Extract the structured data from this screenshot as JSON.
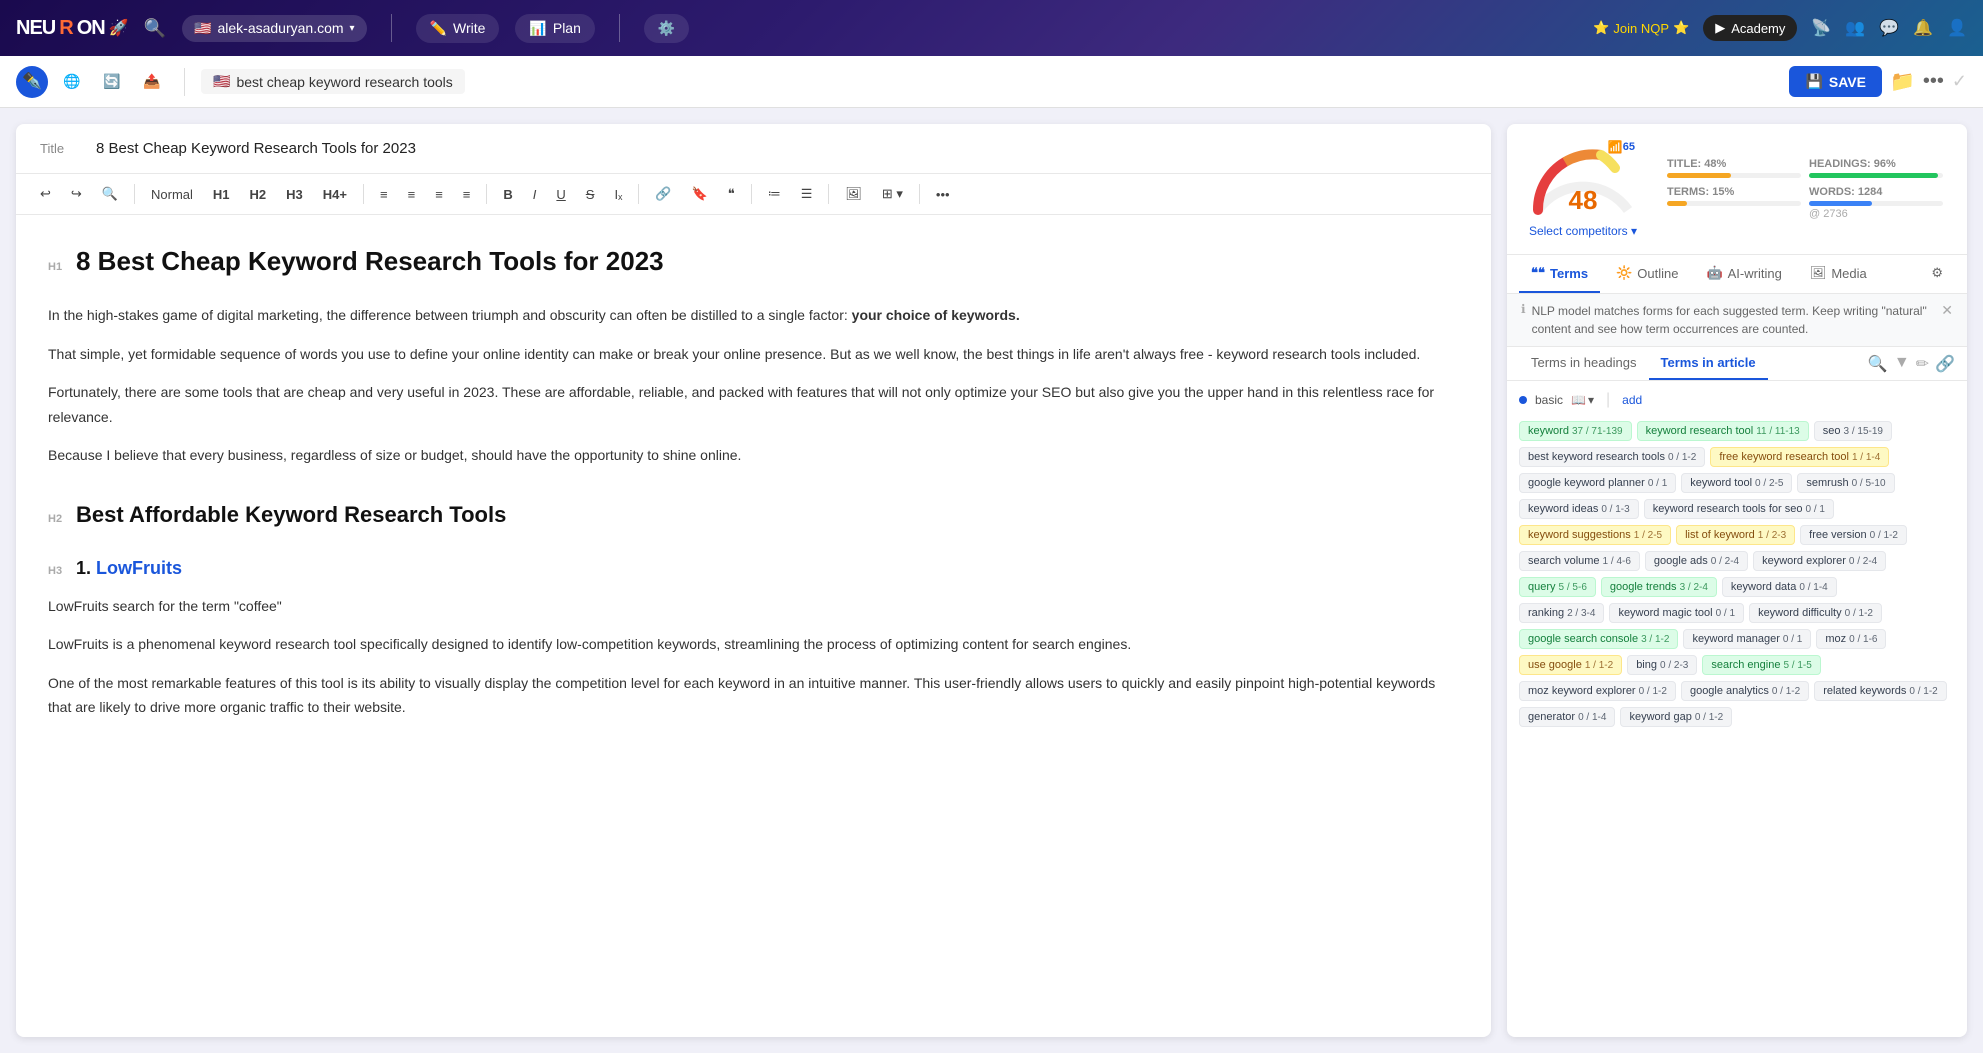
{
  "navbar": {
    "logo": "NEURON",
    "logo_icon": "🚀",
    "domain": "alek-asaduryan.com",
    "flag": "🇺🇸",
    "write_label": "Write",
    "plan_label": "Plan",
    "join_nqp_label": "Join NQP",
    "academy_label": "Academy",
    "write_icon": "✏️",
    "plan_icon": "📊"
  },
  "toolbar2": {
    "doc_title": "best cheap keyword research tools",
    "flag": "🇺🇸",
    "save_label": "SAVE"
  },
  "editor": {
    "title_label": "Title",
    "title_text": "8 Best Cheap Keyword Research Tools for 2023",
    "h1_text": "8 Best Cheap Keyword Research Tools for 2023",
    "h2_1": "Best Affordable Keyword Research Tools",
    "h3_1": "1. LowFruits",
    "p1": "In the high-stakes game of digital marketing, the difference between triumph and obscurity can often be distilled to a single factor: your choice of keywords.",
    "p2": "That simple, yet formidable sequence of words you use to define your online identity can make or break your online presence. But as we well know, the best things in life aren't always free - keyword research tools included.",
    "p3": "Fortunately, there are some tools that are cheap and very useful in 2023. These are affordable, reliable, and packed with features that will not only optimize your SEO but also give you the upper hand in this relentless race for relevance.",
    "p4": "Because I believe that every business, regardless of size or budget, should have the opportunity to shine online.",
    "h3_1_sub1": "LowFruits search for the term \"coffee\"",
    "h3_1_p1": "LowFruits is a phenomenal keyword research tool specifically designed to identify low-competition keywords, streamlining the process of optimizing content for search engines.",
    "h3_1_p2": "One of the most remarkable features of this tool is its ability to visually display the competition level for each keyword in an intuitive manner. This user-friendly allows users to quickly and easily pinpoint high-potential keywords that are likely to drive more organic traffic to their website."
  },
  "score_panel": {
    "score_number": "48",
    "score_wifi": "65",
    "select_competitors": "Select competitors ▾",
    "title_pct": "TITLE: 48%",
    "headings_pct": "HEADINGS: 96%",
    "terms_pct": "TERMS: 15%",
    "words_pct": "WORDS: 1284",
    "words_sub": "@ 2736"
  },
  "right_tabs": {
    "terms_label": "Terms",
    "outline_label": "Outline",
    "ai_writing_label": "AI-writing",
    "media_label": "Media"
  },
  "nlp_notice": "NLP model matches forms for each suggested term. Keep writing \"natural\" content and see how term occurrences are counted.",
  "sub_tabs": {
    "headings_label": "Terms in headings",
    "article_label": "Terms in article"
  },
  "basic_section": {
    "label": "basic",
    "add_label": "add"
  },
  "tags": [
    {
      "text": "keyword",
      "count": "37 / 71-139",
      "type": "green"
    },
    {
      "text": "keyword research tool",
      "count": "11 / 11-13",
      "type": "green"
    },
    {
      "text": "seo",
      "count": "3 / 15-19",
      "type": "gray"
    },
    {
      "text": "best keyword research tools",
      "count": "0 / 1-2",
      "type": "gray"
    },
    {
      "text": "free keyword research tool",
      "count": "1 / 1-4",
      "type": "yellow"
    },
    {
      "text": "google keyword planner",
      "count": "0 / 1",
      "type": "gray"
    },
    {
      "text": "keyword tool",
      "count": "0 / 2-5",
      "type": "gray"
    },
    {
      "text": "semrush",
      "count": "0 / 5-10",
      "type": "gray"
    },
    {
      "text": "keyword ideas",
      "count": "0 / 1-3",
      "type": "gray"
    },
    {
      "text": "keyword research tools for seo",
      "count": "0 / 1",
      "type": "gray"
    },
    {
      "text": "keyword suggestions",
      "count": "1 / 2-5",
      "type": "yellow"
    },
    {
      "text": "list of keyword",
      "count": "1 / 2-3",
      "type": "yellow"
    },
    {
      "text": "free version",
      "count": "0 / 1-2",
      "type": "gray"
    },
    {
      "text": "search volume",
      "count": "1 / 4-6",
      "type": "gray"
    },
    {
      "text": "google ads",
      "count": "0 / 2-4",
      "type": "gray"
    },
    {
      "text": "keyword explorer",
      "count": "0 / 2-4",
      "type": "gray"
    },
    {
      "text": "query",
      "count": "5 / 5-6",
      "type": "green"
    },
    {
      "text": "google trends",
      "count": "3 / 2-4",
      "type": "green"
    },
    {
      "text": "keyword data",
      "count": "0 / 1-4",
      "type": "gray"
    },
    {
      "text": "ranking",
      "count": "2 / 3-4",
      "type": "gray"
    },
    {
      "text": "keyword magic tool",
      "count": "0 / 1",
      "type": "gray"
    },
    {
      "text": "keyword difficulty",
      "count": "0 / 1-2",
      "type": "gray"
    },
    {
      "text": "google search console",
      "count": "3 / 1-2",
      "type": "green"
    },
    {
      "text": "keyword manager",
      "count": "0 / 1",
      "type": "gray"
    },
    {
      "text": "moz",
      "count": "0 / 1-6",
      "type": "gray"
    },
    {
      "text": "use google",
      "count": "1 / 1-2",
      "type": "yellow"
    },
    {
      "text": "bing",
      "count": "0 / 2-3",
      "type": "gray"
    },
    {
      "text": "search engine",
      "count": "5 / 1-5",
      "type": "green"
    },
    {
      "text": "moz keyword explorer",
      "count": "0 / 1-2",
      "type": "gray"
    },
    {
      "text": "google analytics",
      "count": "0 / 1-2",
      "type": "gray"
    },
    {
      "text": "related keywords",
      "count": "0 / 1-2",
      "type": "gray"
    },
    {
      "text": "generator",
      "count": "0 / 1-4",
      "type": "gray"
    },
    {
      "text": "keyword gap",
      "count": "0 / 1-2",
      "type": "gray"
    }
  ]
}
